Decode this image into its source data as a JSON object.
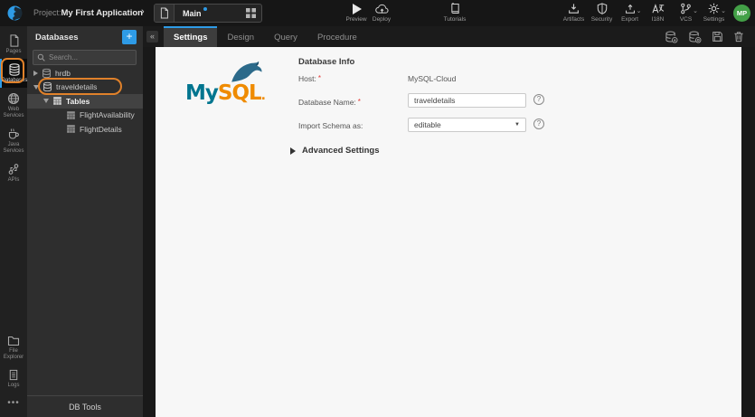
{
  "topbar": {
    "project_label": "Project:",
    "project_name": "My First Application",
    "page_name": "Main",
    "preview": "Preview",
    "deploy": "Deploy",
    "tutorials": "Tutorials",
    "artifacts": "Artifacts",
    "security": "Security",
    "export": "Export",
    "i18n": "I18N",
    "vcs": "VCS",
    "settings": "Settings",
    "avatar_initials": "MP"
  },
  "sidebar": {
    "items": [
      {
        "label": "Pages"
      },
      {
        "label": "Databases"
      },
      {
        "label": "Web Services"
      },
      {
        "label": "Java Services"
      },
      {
        "label": "APIs"
      }
    ],
    "bottom_items": [
      {
        "label": "File Explorer"
      },
      {
        "label": "Logs"
      }
    ]
  },
  "panel": {
    "title": "Databases",
    "search_placeholder": "Search...",
    "tree": [
      {
        "label": "hrdb"
      },
      {
        "label": "traveldetails"
      },
      {
        "label": "Tables"
      },
      {
        "label": "FlightAvailability"
      },
      {
        "label": "FlightDetails"
      }
    ],
    "footer": "DB Tools"
  },
  "main": {
    "tabs": [
      {
        "label": "Settings"
      },
      {
        "label": "Design"
      },
      {
        "label": "Query"
      },
      {
        "label": "Procedure"
      }
    ],
    "logo": {
      "my": "My",
      "sql": "SQL",
      "dot": "."
    },
    "form": {
      "section_title": "Database Info",
      "host_label": "Host:",
      "host_value": "MySQL-Cloud",
      "dbname_label": "Database Name:",
      "dbname_value": "traveldetails",
      "schema_label": "Import Schema as:",
      "schema_value": "editable",
      "advanced_label": "Advanced Settings",
      "required_marker": "*",
      "help_glyph": "?",
      "collapse_glyph": "«"
    }
  },
  "colors": {
    "accent_blue": "#2e9be6",
    "annotation_orange": "#e0812a",
    "mysql_blue": "#00758f",
    "mysql_orange": "#ef8b00",
    "required_red": "#e53935",
    "avatar_green": "#43a047"
  }
}
